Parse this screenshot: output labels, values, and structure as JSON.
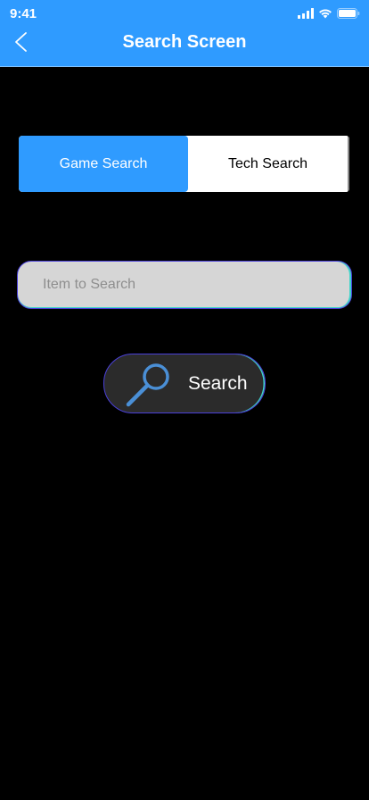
{
  "status_bar": {
    "time": "9:41",
    "icons": [
      "signal-icon",
      "wifi-icon",
      "battery-icon"
    ]
  },
  "header": {
    "title": "Search Screen",
    "back_icon": "chevron-left-icon"
  },
  "segmented_control": {
    "options": [
      {
        "label": "Game Search",
        "selected": true
      },
      {
        "label": "Tech Search",
        "selected": false
      }
    ]
  },
  "search": {
    "placeholder": "Item to Search",
    "value": ""
  },
  "search_button": {
    "label": "Search",
    "icon": "magnifier-icon"
  },
  "colors": {
    "accent": "#2f9bff",
    "background": "#000000",
    "input_background": "#d6d6d6",
    "button_background": "#2b2b2b",
    "border_gradient_start": "#4a40d8",
    "border_gradient_end": "#3fd4c9"
  }
}
